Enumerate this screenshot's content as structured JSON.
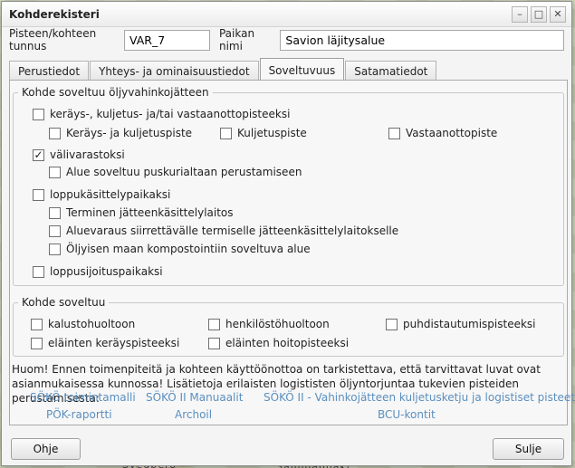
{
  "window": {
    "title": "Kohderekisteri"
  },
  "identity": {
    "id_label": "Pisteen/kohteen tunnus",
    "id_value": "VAR_7",
    "name_label": "Paikan nimi",
    "name_value": "Savion läjitysalue"
  },
  "tabs": [
    {
      "label": "Perustiedot",
      "active": false
    },
    {
      "label": "Yhteys- ja ominaisuustiedot",
      "active": false
    },
    {
      "label": "Soveltuvuus",
      "active": true
    },
    {
      "label": "Satamatiedot",
      "active": false
    }
  ],
  "oil_group": {
    "legend": "Kohde soveltuu öljyvahinkojätteen",
    "items": [
      {
        "label": "keräys-, kuljetus- ja/tai vastaanottopisteeksi",
        "checked": false
      },
      {
        "label": "Keräys- ja kuljetuspiste",
        "checked": false
      },
      {
        "label": "Kuljetuspiste",
        "checked": false
      },
      {
        "label": "Vastaanottopiste",
        "checked": false
      },
      {
        "label": "välivarastoksi",
        "checked": true
      },
      {
        "label": "Alue soveltuu puskurialtaan perustamiseen",
        "checked": false
      },
      {
        "label": "loppukäsittelypaikaksi",
        "checked": false
      },
      {
        "label": "Terminen jätteenkäsittelylaitos",
        "checked": false
      },
      {
        "label": "Aluevaraus siirrettävälle termiselle jätteenkäsittelylaitokselle",
        "checked": false
      },
      {
        "label": "Öljyisen maan kompostointiin soveltuva alue",
        "checked": false
      },
      {
        "label": "loppusijoituspaikaksi",
        "checked": false
      }
    ]
  },
  "other_group": {
    "legend": "Kohde soveltuu",
    "items": [
      {
        "label": "kalustohuoltoon",
        "checked": false
      },
      {
        "label": "henkilöstöhuoltoon",
        "checked": false
      },
      {
        "label": "puhdistautumispisteeksi",
        "checked": false
      },
      {
        "label": "eläinten keräyspisteeksi",
        "checked": false
      },
      {
        "label": "eläinten hoitopisteeksi",
        "checked": false
      }
    ]
  },
  "note": {
    "text": "Huom! Ennen toimenpiteitä ja kohteen käyttöönottoa on tarkistettava, että tarvittavat luvat ovat asianmukaisessa kunnossa! Lisätietoja erilaisten logististen öljyntorjuntaa tukevien pisteiden perustamisesta:"
  },
  "links": [
    "SÖKÖ toimintamalli",
    "SÖKÖ II Manuaalit",
    "SÖKÖ II - Vahinkojätteen kuljetusketju ja logistiset pisteet",
    "PÖK-raportti",
    "Archoil",
    "BCU-kontit"
  ],
  "buttons": {
    "help": "Ohje",
    "close": "Sulje"
  },
  "background": {
    "map_label_1": "Svedbero",
    "map_label_2": "Sammalmäki"
  },
  "colors": {
    "link": "#5b8fbf",
    "dialog_bg": "#f4f4f4",
    "map_bg": "#c9d3b7"
  }
}
